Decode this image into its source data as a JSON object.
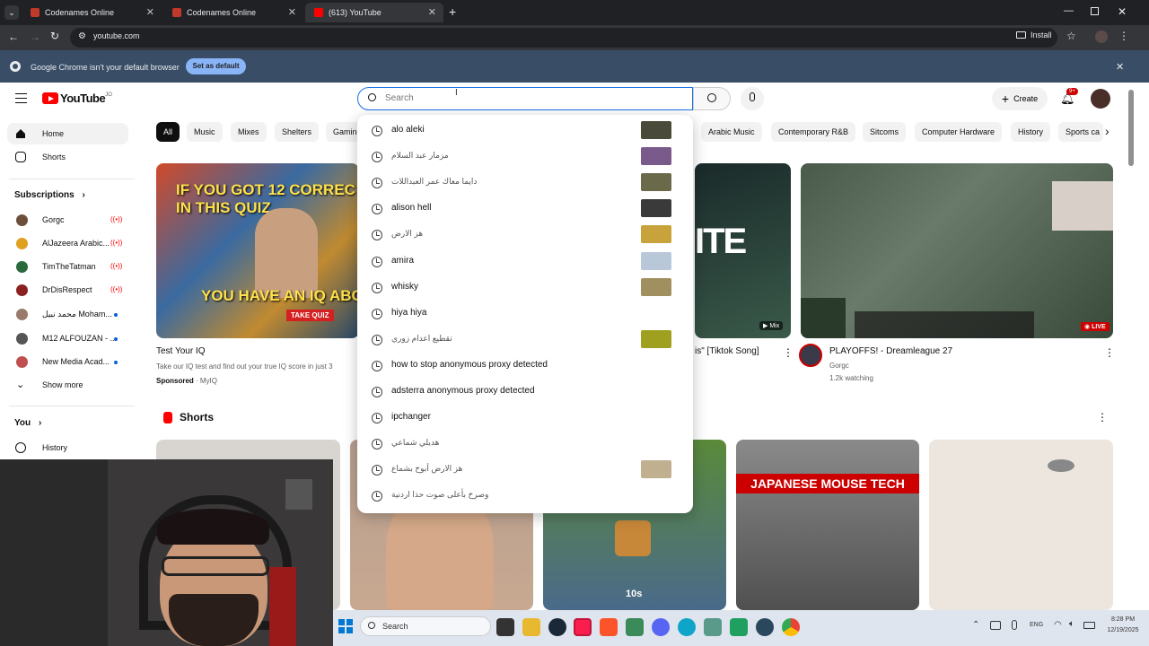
{
  "browser": {
    "tabs": [
      {
        "title": "Codenames Online",
        "active": false
      },
      {
        "title": "Codenames Online",
        "active": false
      },
      {
        "title": "(613) YouTube",
        "active": true
      }
    ],
    "url": "youtube.com",
    "install_label": "Install",
    "infobar": {
      "message": "Google Chrome isn't your default browser",
      "button": "Set as default"
    }
  },
  "youtube": {
    "logo": "YouTube",
    "logo_suffix": "JO",
    "search_placeholder": "Search",
    "create_label": "Create",
    "notif_badge": "9+",
    "chips": [
      "All",
      "Music",
      "Mixes",
      "Shelters",
      "Gaming",
      "Arabic Music",
      "Contemporary R&B",
      "Sitcoms",
      "Computer Hardware",
      "History",
      "Sports ca"
    ],
    "sidebar": {
      "home": "Home",
      "shorts": "Shorts",
      "subscriptions_heading": "Subscriptions",
      "subscriptions": [
        {
          "name": "Gorgc",
          "live": true
        },
        {
          "name": "AlJazeera Arabic...",
          "live": true
        },
        {
          "name": "TimTheTatman",
          "live": true
        },
        {
          "name": "DrDisRespect",
          "live": true
        },
        {
          "name": "محمد نبيل Moham...",
          "live": false
        },
        {
          "name": "M12 ALFOUZAN - ...",
          "live": false
        },
        {
          "name": "New Media Acad...",
          "live": false
        }
      ],
      "show_more": "Show more",
      "you_heading": "You",
      "history": "History"
    },
    "videos": [
      {
        "title": "Test Your IQ",
        "description": "Take our IQ test and find out your true IQ score in just 3",
        "sponsored": "Sponsored",
        "channel": "MyIQ",
        "thumb_text_top": "IF YOU GOT 12 CORREC IN THIS QUIZ",
        "thumb_text_bottom": "YOU HAVE AN IQ ABO",
        "take_quiz": "TAKE QUIZ"
      },
      {
        "title": "is\" [Tiktok Song]",
        "badge": "Mix",
        "thumb_text": "ITE"
      },
      {
        "title": "PLAYOFFS! - Dreamleague 27",
        "channel": "Gorgc",
        "meta": "1.2k watching",
        "badge": "LIVE"
      }
    ],
    "shorts_heading": "Shorts",
    "shorts": [
      {
        "overlay": ""
      },
      {
        "overlay": ""
      },
      {
        "overlay": "10s"
      },
      {
        "overlay": "JAPANESE MOUSE TECH"
      },
      {
        "overlay": ""
      }
    ],
    "suggestions": [
      {
        "text": "alo aleki",
        "arabic": false,
        "thumb": "#4a4a3a"
      },
      {
        "text": "مزمار عبد السلام",
        "arabic": true,
        "thumb": "#7a5a8a"
      },
      {
        "text": "دايما معاك عمر العبداللات",
        "arabic": true,
        "thumb": "#6a6a4a"
      },
      {
        "text": "alison hell",
        "arabic": false,
        "thumb": "#3a3a3a"
      },
      {
        "text": "هز الارض",
        "arabic": true,
        "thumb": "#c8a23a"
      },
      {
        "text": "amira",
        "arabic": false,
        "thumb": "#b8c8d8"
      },
      {
        "text": "whisky",
        "arabic": false,
        "thumb": "#a09060"
      },
      {
        "text": "hiya hiya",
        "arabic": false,
        "thumb": ""
      },
      {
        "text": "تقطيع اعدام زوري",
        "arabic": true,
        "thumb": "#a0a020"
      },
      {
        "text": "how to stop anonymous proxy detected",
        "arabic": false,
        "thumb": ""
      },
      {
        "text": "adsterra anonymous proxy detected",
        "arabic": false,
        "thumb": ""
      },
      {
        "text": "ipchanger",
        "arabic": false,
        "thumb": ""
      },
      {
        "text": "هديلي شماعي",
        "arabic": true,
        "thumb": ""
      },
      {
        "text": "هز الارض أبوح بشماع",
        "arabic": true,
        "thumb": "#c0b090"
      },
      {
        "text": "وصرخ بأعلى صوت حذا اردنية",
        "arabic": true,
        "thumb": ""
      }
    ]
  },
  "taskbar": {
    "search": "Search",
    "lang": "ENG",
    "time": "8:28 PM",
    "date": "12/19/2025"
  },
  "colors": {
    "yt_red": "#ff0000",
    "chrome_dark": "#202124",
    "infobar": "#394e66",
    "link_blue": "#1a73e8"
  }
}
